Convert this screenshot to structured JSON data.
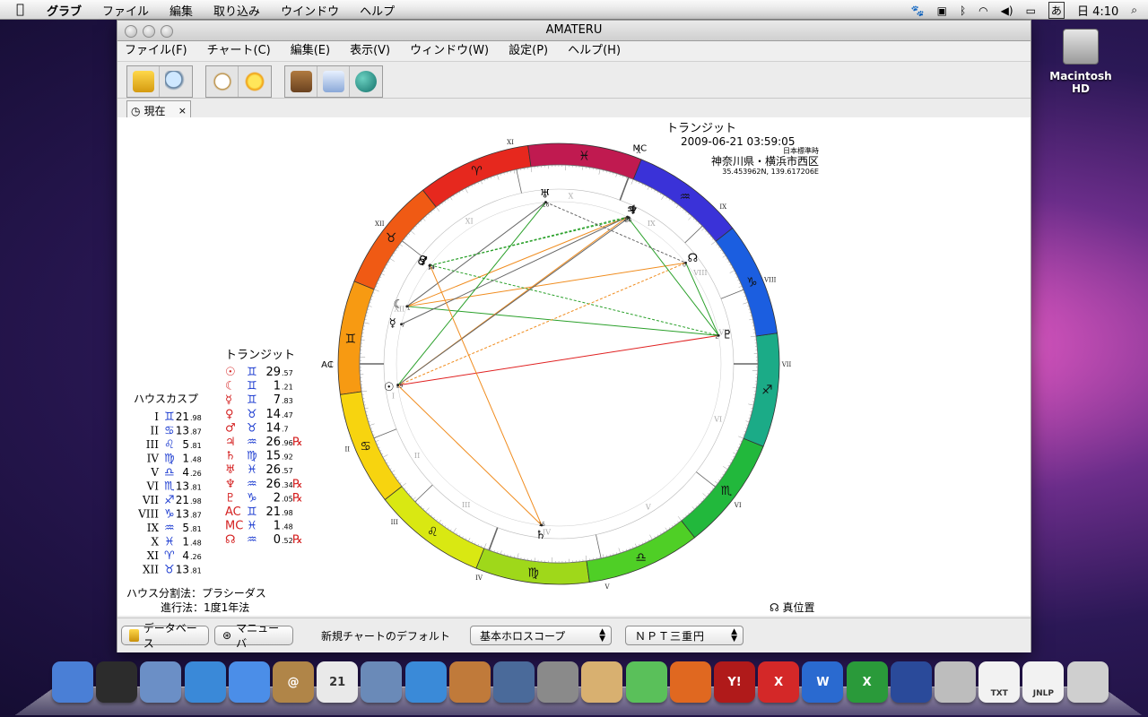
{
  "menubar": {
    "items": [
      "グラブ",
      "ファイル",
      "編集",
      "取り込み",
      "ウインドウ",
      "ヘルプ"
    ],
    "clock": "日 4:10",
    "input_method": "あ"
  },
  "desktop": {
    "hd_label": "Macintosh HD"
  },
  "window": {
    "title": "AMATERU",
    "menu": [
      "ファイル(F)",
      "チャート(C)",
      "編集(E)",
      "表示(V)",
      "ウィンドウ(W)",
      "設定(P)",
      "ヘルプ(H)"
    ],
    "tab_label": "現在",
    "tab_close": "×"
  },
  "chart_header": {
    "title": "トランジット",
    "datetime": "2009-06-21 03:59:05",
    "timezone": "日本標準時",
    "place": "神奈川県・横浜市西区",
    "coords": "35.453962N, 139.617206E"
  },
  "transit_table": {
    "title": "トランジット",
    "rows": [
      {
        "planet": "☉",
        "sign": "♊",
        "deg": "29",
        "frac": ".57",
        "retro": ""
      },
      {
        "planet": "☾",
        "sign": "♊",
        "deg": "1",
        "frac": ".21",
        "retro": ""
      },
      {
        "planet": "☿",
        "sign": "♊",
        "deg": "7",
        "frac": ".83",
        "retro": ""
      },
      {
        "planet": "♀",
        "sign": "♉",
        "deg": "14",
        "frac": ".47",
        "retro": ""
      },
      {
        "planet": "♂",
        "sign": "♉",
        "deg": "14",
        "frac": ".7",
        "retro": ""
      },
      {
        "planet": "♃",
        "sign": "♒",
        "deg": "26",
        "frac": ".96",
        "retro": "℞"
      },
      {
        "planet": "♄",
        "sign": "♍",
        "deg": "15",
        "frac": ".92",
        "retro": ""
      },
      {
        "planet": "♅",
        "sign": "♓",
        "deg": "26",
        "frac": ".57",
        "retro": ""
      },
      {
        "planet": "♆",
        "sign": "♒",
        "deg": "26",
        "frac": ".34",
        "retro": "℞"
      },
      {
        "planet": "♇",
        "sign": "♑",
        "deg": "2",
        "frac": ".05",
        "retro": "℞"
      },
      {
        "planet": "AC",
        "sign": "♊",
        "deg": "21",
        "frac": ".98",
        "retro": ""
      },
      {
        "planet": "MC",
        "sign": "♓",
        "deg": "1",
        "frac": ".48",
        "retro": ""
      },
      {
        "planet": "☊",
        "sign": "♒",
        "deg": "0",
        "frac": ".52",
        "retro": "℞"
      }
    ]
  },
  "house_table": {
    "title": "ハウスカスプ",
    "rows": [
      {
        "num": "I",
        "sign": "♊",
        "deg": "21",
        "frac": ".98"
      },
      {
        "num": "II",
        "sign": "♋",
        "deg": "13",
        "frac": ".87"
      },
      {
        "num": "III",
        "sign": "♌",
        "deg": "5",
        "frac": ".81"
      },
      {
        "num": "IV",
        "sign": "♍",
        "deg": "1",
        "frac": ".48"
      },
      {
        "num": "V",
        "sign": "♎",
        "deg": "4",
        "frac": ".26"
      },
      {
        "num": "VI",
        "sign": "♏",
        "deg": "13",
        "frac": ".81"
      },
      {
        "num": "VII",
        "sign": "♐",
        "deg": "21",
        "frac": ".98"
      },
      {
        "num": "VIII",
        "sign": "♑",
        "deg": "13",
        "frac": ".87"
      },
      {
        "num": "IX",
        "sign": "♒",
        "deg": "5",
        "frac": ".81"
      },
      {
        "num": "X",
        "sign": "♓",
        "deg": "1",
        "frac": ".48"
      },
      {
        "num": "XI",
        "sign": "♈",
        "deg": "4",
        "frac": ".26"
      },
      {
        "num": "XII",
        "sign": "♉",
        "deg": "13",
        "frac": ".81"
      }
    ]
  },
  "footer_info": {
    "house_system": "ハウス分割法：プラシーダス",
    "progression": "進行法：1度1年法",
    "true_position": "☊ 真位置"
  },
  "wheel": {
    "ac_label": "AC",
    "mc_label": "MC",
    "ac_longitude": 81.98,
    "sign_glyphs": [
      "♈",
      "♉",
      "♊",
      "♋",
      "♌",
      "♍",
      "♎",
      "♏",
      "♐",
      "♑",
      "♒",
      "♓"
    ],
    "sign_colors": [
      "#e6281e",
      "#f05a14",
      "#f79a12",
      "#f7d40f",
      "#d9e812",
      "#9fd81a",
      "#4fcf26",
      "#22b83c",
      "#1bab87",
      "#1b5ee0",
      "#3a32d8",
      "#c01a50"
    ],
    "house_cusps": [
      81.98,
      103.87,
      125.81,
      151.48,
      184.26,
      223.81,
      261.98,
      283.87,
      305.81,
      331.48,
      4.26,
      43.81
    ],
    "house_numerals": [
      "I",
      "II",
      "III",
      "IV",
      "V",
      "VI",
      "VII",
      "VIII",
      "IX",
      "X",
      "XI",
      "XII"
    ],
    "planets": [
      {
        "glyph": "☉",
        "lon": 89.57,
        "deg": "29"
      },
      {
        "glyph": "☾",
        "lon": 61.21,
        "deg": "1"
      },
      {
        "glyph": "☿",
        "lon": 67.83,
        "deg": "7"
      },
      {
        "glyph": "♀",
        "lon": 44.47,
        "deg": "14"
      },
      {
        "glyph": "♂",
        "lon": 44.7,
        "deg": "14"
      },
      {
        "glyph": "♃",
        "lon": 326.96,
        "deg": "26"
      },
      {
        "glyph": "♄",
        "lon": 165.92,
        "deg": "15"
      },
      {
        "glyph": "♅",
        "lon": 356.57,
        "deg": "26"
      },
      {
        "glyph": "♆",
        "lon": 326.34,
        "deg": "26"
      },
      {
        "glyph": "♇",
        "lon": 272.05,
        "deg": "2"
      },
      {
        "glyph": "☊",
        "lon": 300.52,
        "deg": "0"
      }
    ],
    "aspects": [
      {
        "a": 0,
        "b": 6,
        "color": "#f08c1e",
        "dash": false
      },
      {
        "a": 0,
        "b": 9,
        "color": "#e02020",
        "dash": false
      },
      {
        "a": 1,
        "b": 9,
        "color": "#2aa02a",
        "dash": false
      },
      {
        "a": 1,
        "b": 5,
        "color": "#f08c1e",
        "dash": false
      },
      {
        "a": 1,
        "b": 7,
        "color": "#666666",
        "dash": false
      },
      {
        "a": 1,
        "b": 10,
        "color": "#f08c1e",
        "dash": false
      },
      {
        "a": 3,
        "b": 9,
        "color": "#2aa02a",
        "dash": true
      },
      {
        "a": 4,
        "b": 5,
        "color": "#2aa02a",
        "dash": true
      },
      {
        "a": 2,
        "b": 5,
        "color": "#666666",
        "dash": false
      },
      {
        "a": 0,
        "b": 5,
        "color": "#f08c1e",
        "dash": false
      },
      {
        "a": 0,
        "b": 8,
        "color": "#666666",
        "dash": false
      },
      {
        "a": 0,
        "b": 10,
        "color": "#f08c1e",
        "dash": true
      },
      {
        "a": 0,
        "b": 7,
        "color": "#2aa02a",
        "dash": false
      },
      {
        "a": 3,
        "b": 6,
        "color": "#f08c1e",
        "dash": false
      },
      {
        "a": 4,
        "b": 8,
        "color": "#2aa02a",
        "dash": true
      },
      {
        "a": 5,
        "b": 9,
        "color": "#2aa02a",
        "dash": false
      },
      {
        "a": 10,
        "b": 9,
        "color": "#2aa02a",
        "dash": false
      },
      {
        "a": 7,
        "b": 10,
        "color": "#666666",
        "dash": true
      }
    ]
  },
  "bottom": {
    "db_button": "データベース",
    "manual_button": "マニューバ",
    "default_label": "新規チャートのデフォルト",
    "chart_type_select": "基本ホロスコープ",
    "ring_select": "ＮＰＴ三重円"
  },
  "dock": {
    "items": [
      {
        "name": "finder",
        "color": "#4a7fd6",
        "label": ""
      },
      {
        "name": "dashboard",
        "color": "#2c2c2c",
        "label": ""
      },
      {
        "name": "mail",
        "color": "#6b8fc6",
        "label": ""
      },
      {
        "name": "safari",
        "color": "#3a89d8",
        "label": ""
      },
      {
        "name": "ichat",
        "color": "#4b8ee8",
        "label": ""
      },
      {
        "name": "address-book",
        "color": "#b08548",
        "label": "@"
      },
      {
        "name": "ical",
        "color": "#e9e9e9",
        "label": "21"
      },
      {
        "name": "iphoto",
        "color": "#6a8ab8",
        "label": ""
      },
      {
        "name": "itunes",
        "color": "#3a8ad8",
        "label": ""
      },
      {
        "name": "image-capture",
        "color": "#c07a3a",
        "label": ""
      },
      {
        "name": "spaces",
        "color": "#4a6a9a",
        "label": ""
      },
      {
        "name": "preferences",
        "color": "#8a8a8a",
        "label": ""
      },
      {
        "name": "preview",
        "color": "#d8b070",
        "label": ""
      },
      {
        "name": "twitter",
        "color": "#5ac05a",
        "label": ""
      },
      {
        "name": "firefox",
        "color": "#e06820",
        "label": ""
      },
      {
        "name": "yahoo",
        "color": "#b01a1a",
        "label": "Y!"
      },
      {
        "name": "app-x",
        "color": "#d42828",
        "label": "X"
      },
      {
        "name": "word",
        "color": "#2a6ad0",
        "label": "W"
      },
      {
        "name": "excel",
        "color": "#2a9a3a",
        "label": "X"
      },
      {
        "name": "amateru",
        "color": "#2a4a9a",
        "label": ""
      },
      {
        "name": "scissors",
        "color": "#bdbdbd",
        "label": ""
      },
      {
        "name": "txt-file",
        "color": "#f2f2f2",
        "label": "TXT"
      },
      {
        "name": "jnlp-file",
        "color": "#f2f2f2",
        "label": "JNLP"
      },
      {
        "name": "trash",
        "color": "#cfcfcf",
        "label": ""
      }
    ]
  }
}
